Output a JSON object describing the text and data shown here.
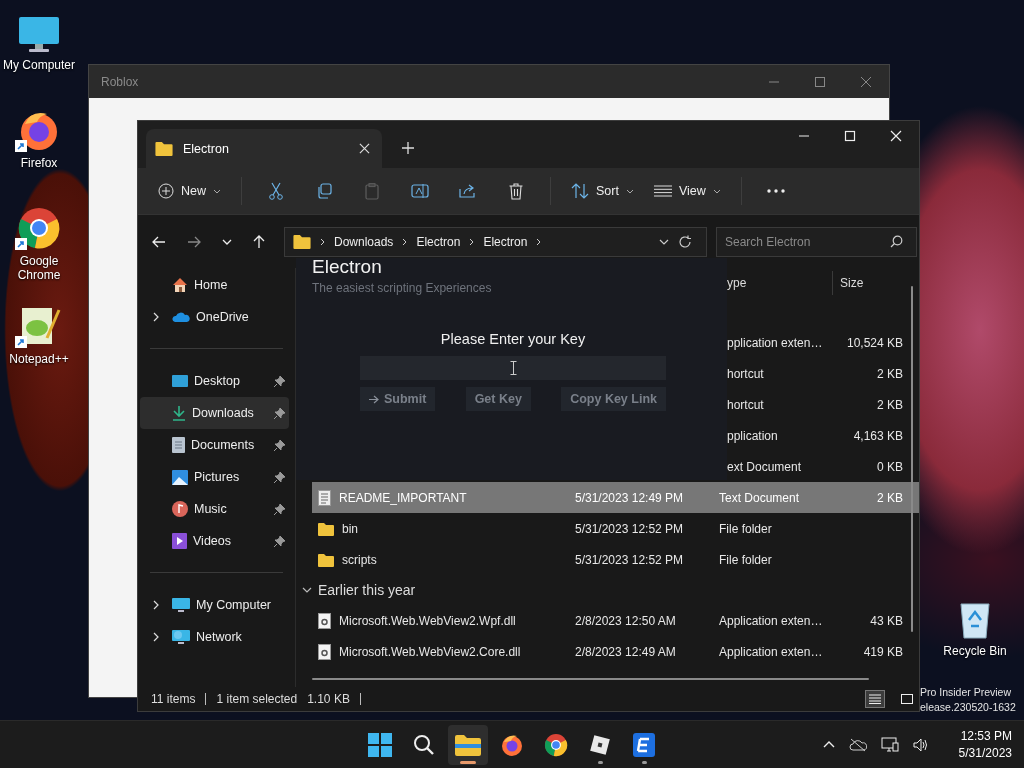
{
  "desktop": {
    "icons": [
      {
        "label": "My Computer",
        "kind": "computer",
        "shortcut": false
      },
      {
        "label": "Firefox",
        "kind": "firefox",
        "shortcut": true
      },
      {
        "label": "Google Chrome",
        "kind": "chrome",
        "shortcut": true
      },
      {
        "label": "Notepad++",
        "kind": "notepad",
        "shortcut": true
      }
    ],
    "recycle_bin": {
      "label": "Recycle Bin"
    },
    "build_info": [
      "Pro Insider Preview",
      "elease.230520-1632"
    ]
  },
  "roblox_window": {
    "title": "Roblox"
  },
  "explorer": {
    "tab": {
      "title": "Electron"
    },
    "toolbar": {
      "new": "New",
      "sort": "Sort",
      "view": "View",
      "paste_disabled": true
    },
    "breadcrumb": [
      "Downloads",
      "Electron",
      "Electron"
    ],
    "search": {
      "placeholder": "Search Electron"
    },
    "sidebar": [
      [
        {
          "label": "Home",
          "kind": "home",
          "selected": false
        },
        {
          "label": "OneDrive",
          "kind": "onedrive",
          "selected": false,
          "expanded": false
        }
      ],
      [
        {
          "label": "Desktop",
          "kind": "desktop",
          "selected": false,
          "pinned": true
        },
        {
          "label": "Downloads",
          "kind": "downloads",
          "selected": true,
          "pinned": true
        },
        {
          "label": "Documents",
          "kind": "documents",
          "selected": false,
          "pinned": true
        },
        {
          "label": "Pictures",
          "kind": "pictures",
          "selected": false,
          "pinned": true
        },
        {
          "label": "Music",
          "kind": "music",
          "selected": false,
          "pinned": true
        },
        {
          "label": "Videos",
          "kind": "videos",
          "selected": false,
          "pinned": true
        }
      ],
      [
        {
          "label": "My Computer",
          "kind": "computer",
          "selected": false,
          "expanded": false
        },
        {
          "label": "Network",
          "kind": "network",
          "selected": false,
          "expanded": false
        }
      ]
    ],
    "columns": {
      "type": "ype",
      "size": "Size"
    },
    "rows": [
      {
        "kind": "covered",
        "type": "pplication exten…",
        "size": "10,524 KB",
        "selected": false
      },
      {
        "kind": "covered",
        "type": "hortcut",
        "size": "2 KB",
        "selected": false
      },
      {
        "kind": "covered",
        "type": "hortcut",
        "size": "2 KB",
        "selected": false
      },
      {
        "kind": "covered",
        "type": "pplication",
        "size": "4,163 KB",
        "selected": false
      },
      {
        "kind": "covered",
        "type": "ext Document",
        "size": "0 KB",
        "selected": false
      },
      {
        "kind": "text",
        "name": "README_IMPORTANT",
        "date": "5/31/2023 12:49 PM",
        "type": "Text Document",
        "size": "2 KB",
        "selected": true
      },
      {
        "kind": "folder",
        "name": "bin",
        "date": "5/31/2023 12:52 PM",
        "type": "File folder",
        "selected": false
      },
      {
        "kind": "folder",
        "name": "scripts",
        "date": "5/31/2023 12:52 PM",
        "type": "File folder",
        "selected": false
      },
      {
        "kind": "group",
        "label": "Earlier this year",
        "expanded": true
      },
      {
        "kind": "dll",
        "name": "Microsoft.Web.WebView2.Wpf.dll",
        "date": "2/8/2023 12:50 AM",
        "type": "Application exten…",
        "size": "43 KB",
        "selected": false
      },
      {
        "kind": "dll",
        "name": "Microsoft.Web.WebView2.Core.dll",
        "date": "2/8/2023 12:49 AM",
        "type": "Application exten…",
        "size": "419 KB",
        "selected": false
      }
    ],
    "status_bar": {
      "count": "11 items",
      "selection": "1 item selected",
      "selection_size": "1.10 KB",
      "views": [
        {
          "kind": "details",
          "selected": true
        },
        {
          "kind": "tiles",
          "selected": false
        }
      ]
    }
  },
  "electron_dialog": {
    "title": "Electron",
    "subtitle": "The easiest scripting Experiences",
    "prompt": "Please Enter your Key",
    "buttons": [
      {
        "label": "Submit",
        "kind": "submit"
      },
      {
        "label": "Get Key",
        "kind": "plain"
      },
      {
        "label": "Copy Key Link",
        "kind": "plain"
      }
    ]
  },
  "taskbar": {
    "apps": [
      {
        "kind": "start",
        "active": false,
        "running": false
      },
      {
        "kind": "search",
        "active": false,
        "running": false
      },
      {
        "kind": "explorer",
        "active": true,
        "running": true
      },
      {
        "kind": "firefox",
        "active": false,
        "running": false
      },
      {
        "kind": "chrome",
        "active": false,
        "running": false
      },
      {
        "kind": "roblox",
        "active": false,
        "running": true
      },
      {
        "kind": "electron",
        "active": false,
        "running": true
      }
    ],
    "clock": {
      "time": "12:53 PM",
      "date": "5/31/2023"
    }
  }
}
